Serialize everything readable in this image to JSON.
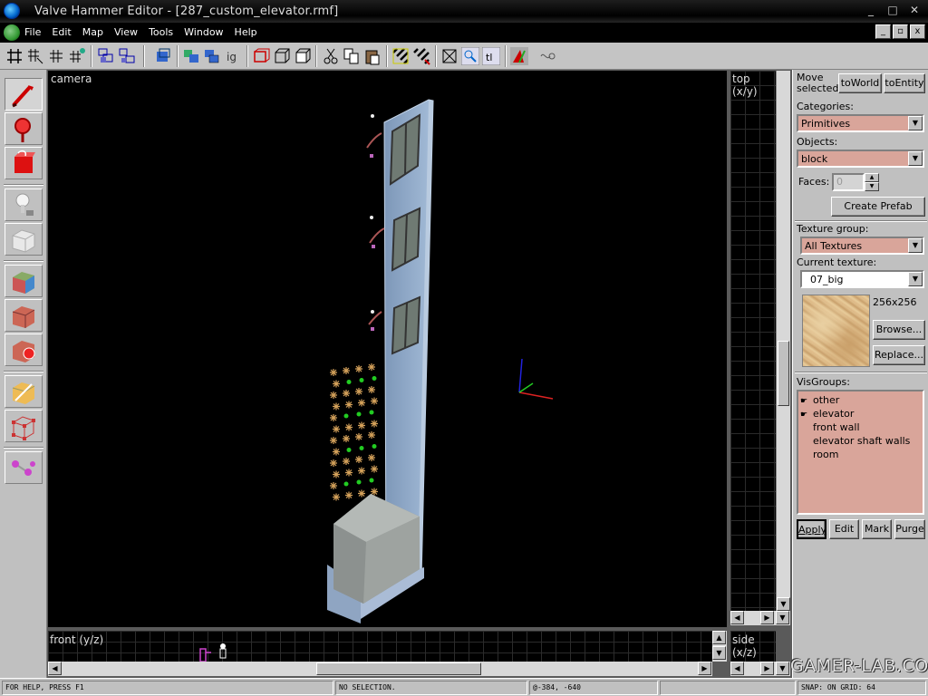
{
  "window": {
    "title": "Valve Hammer Editor - [287_custom_elevator.rmf]",
    "controls": [
      "_",
      "□",
      "✕"
    ]
  },
  "menu": {
    "items": [
      "File",
      "Edit",
      "Map",
      "View",
      "Tools",
      "Window",
      "Help"
    ],
    "mdi_controls": [
      "_",
      "▫",
      "x"
    ]
  },
  "toolbar": {
    "icons": [
      "grid-toggle-icon",
      "grid-3d-icon",
      "grid-smaller-icon",
      "grid-larger-icon",
      "group-icon",
      "ungroup-icon",
      "carve-icon",
      "hide-icon",
      "unhide-icon",
      "texture-lock-icon",
      "ignore-groups-icon",
      "toggle-face-icon",
      "toggle-vertex-icon",
      "toggle-bbox-icon",
      "cut-icon",
      "copy-icon",
      "paste-icon",
      "hatch-a-icon",
      "hatch-b-icon",
      "select-icon",
      "zoom-icon",
      "texture-lock-label-icon",
      "run-map-icon",
      "cordon-icon"
    ]
  },
  "tools": [
    "selection-tool-icon",
    "magnify-tool-icon",
    "camera-tool-icon",
    "entity-tool-icon",
    "block-tool-icon",
    "texture-application-tool-icon",
    "apply-texture-tool-icon",
    "decal-tool-icon",
    "clipping-tool-icon",
    "vertex-tool-icon",
    "path-tool-icon"
  ],
  "views": {
    "camera_label": "camera",
    "top_label": "top (x/y)",
    "front_label": "front (y/z)",
    "side_label": "side (x/z)"
  },
  "panel": {
    "move_selected_label": "Move selected:",
    "to_world": "toWorld",
    "to_entity": "toEntity",
    "categories_label": "Categories:",
    "categories_value": "Primitives",
    "objects_label": "Objects:",
    "objects_value": "block",
    "faces_label": "Faces:",
    "faces_value": "0",
    "create_prefab": "Create Prefab",
    "texture_group_label": "Texture group:",
    "texture_group_value": "All Textures",
    "current_texture_label": "Current texture:",
    "current_texture_value": "07_big",
    "texture_size": "256x256",
    "browse": "Browse...",
    "replace": "Replace...",
    "visgroups_label": "VisGroups:",
    "visgroups": [
      {
        "name": "other",
        "visible": true
      },
      {
        "name": "elevator",
        "visible": true
      },
      {
        "name": "front wall",
        "visible": false
      },
      {
        "name": "elevator shaft walls",
        "visible": false
      },
      {
        "name": "room",
        "visible": false
      }
    ],
    "apply": "Apply",
    "edit": "Edit",
    "mark": "Mark",
    "purge": "Purge"
  },
  "status": {
    "help": "For Help, press F1",
    "selection": "No selection.",
    "coords": "@-384, -640",
    "snap": "Snap: On Grid: 64"
  },
  "watermark": "GAMER-LAB.COM",
  "colors": {
    "panel_bg": "#c0c0c0",
    "combo_bg": "#d9a59a",
    "viewport_bg": "#000000",
    "shaft_wall": "#8aa6c8",
    "grid_line": "#2b2b2b"
  }
}
